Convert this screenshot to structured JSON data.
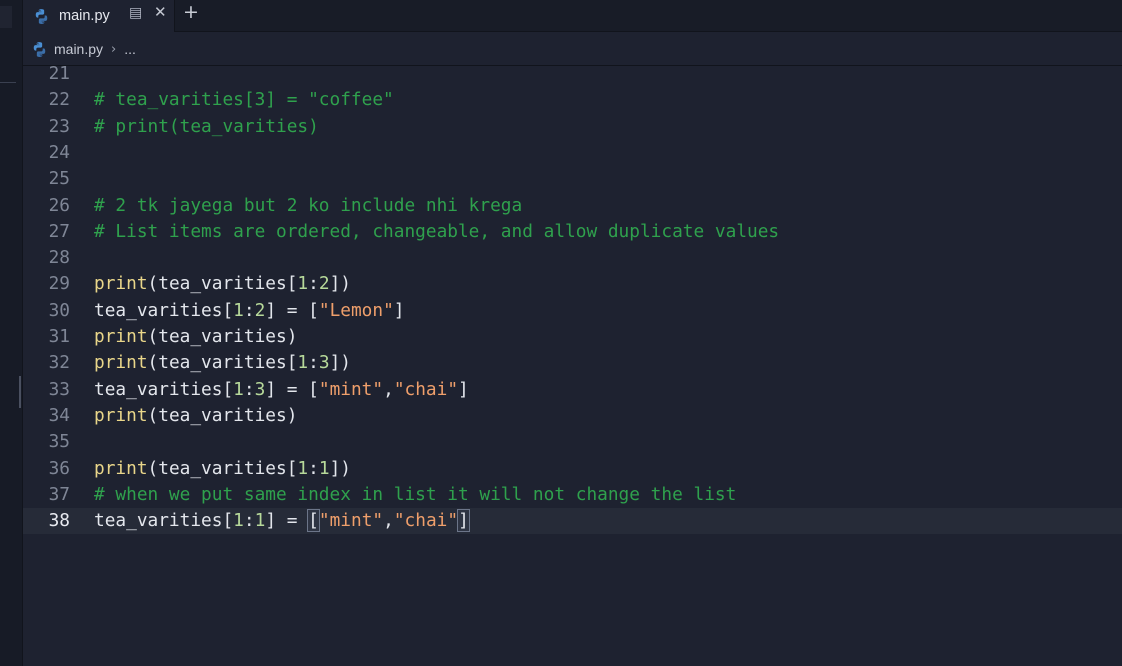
{
  "tab": {
    "label": "main.py"
  },
  "breadcrumb": {
    "file": "main.py",
    "more": "..."
  },
  "colors": {
    "comment": "#2fa14d",
    "function": "#e9d68a",
    "number": "#b7d99a",
    "string": "#ef9f6b"
  },
  "editor": {
    "current_line": "38",
    "lines": [
      {
        "n": "21",
        "tokens": []
      },
      {
        "n": "22",
        "tokens": [
          {
            "t": "c",
            "v": "# tea_varities[3] = \"coffee\""
          }
        ]
      },
      {
        "n": "23",
        "tokens": [
          {
            "t": "c",
            "v": "# print(tea_varities)"
          }
        ]
      },
      {
        "n": "24",
        "tokens": []
      },
      {
        "n": "25",
        "tokens": []
      },
      {
        "n": "26",
        "tokens": [
          {
            "t": "c",
            "v": "# 2 tk jayega but 2 ko include nhi krega"
          }
        ]
      },
      {
        "n": "27",
        "tokens": [
          {
            "t": "c",
            "v": "# List items are ordered, changeable, and allow duplicate values"
          }
        ]
      },
      {
        "n": "28",
        "tokens": []
      },
      {
        "n": "29",
        "tokens": [
          {
            "t": "f",
            "v": "print"
          },
          {
            "t": "p",
            "v": "(tea_varities["
          },
          {
            "t": "n",
            "v": "1"
          },
          {
            "t": "p",
            "v": ":"
          },
          {
            "t": "n",
            "v": "2"
          },
          {
            "t": "p",
            "v": "])"
          }
        ]
      },
      {
        "n": "30",
        "tokens": [
          {
            "t": "p",
            "v": "tea_varities["
          },
          {
            "t": "n",
            "v": "1"
          },
          {
            "t": "p",
            "v": ":"
          },
          {
            "t": "n",
            "v": "2"
          },
          {
            "t": "p",
            "v": "] = ["
          },
          {
            "t": "s",
            "v": "\"Lemon\""
          },
          {
            "t": "p",
            "v": "]"
          }
        ]
      },
      {
        "n": "31",
        "tokens": [
          {
            "t": "f",
            "v": "print"
          },
          {
            "t": "p",
            "v": "(tea_varities)"
          }
        ]
      },
      {
        "n": "32",
        "tokens": [
          {
            "t": "f",
            "v": "print"
          },
          {
            "t": "p",
            "v": "(tea_varities["
          },
          {
            "t": "n",
            "v": "1"
          },
          {
            "t": "p",
            "v": ":"
          },
          {
            "t": "n",
            "v": "3"
          },
          {
            "t": "p",
            "v": "])"
          }
        ]
      },
      {
        "n": "33",
        "tokens": [
          {
            "t": "p",
            "v": "tea_varities["
          },
          {
            "t": "n",
            "v": "1"
          },
          {
            "t": "p",
            "v": ":"
          },
          {
            "t": "n",
            "v": "3"
          },
          {
            "t": "p",
            "v": "] = ["
          },
          {
            "t": "s",
            "v": "\"mint\""
          },
          {
            "t": "p",
            "v": ","
          },
          {
            "t": "s",
            "v": "\"chai\""
          },
          {
            "t": "p",
            "v": "]"
          }
        ]
      },
      {
        "n": "34",
        "tokens": [
          {
            "t": "f",
            "v": "print"
          },
          {
            "t": "p",
            "v": "(tea_varities)"
          }
        ]
      },
      {
        "n": "35",
        "tokens": []
      },
      {
        "n": "36",
        "tokens": [
          {
            "t": "f",
            "v": "print"
          },
          {
            "t": "p",
            "v": "(tea_varities["
          },
          {
            "t": "n",
            "v": "1"
          },
          {
            "t": "p",
            "v": ":"
          },
          {
            "t": "n",
            "v": "1"
          },
          {
            "t": "p",
            "v": "])"
          }
        ]
      },
      {
        "n": "37",
        "tokens": [
          {
            "t": "c",
            "v": "# when we put same index in list it will not change the list"
          }
        ]
      },
      {
        "n": "38",
        "tokens": [
          {
            "t": "p",
            "v": "tea_varities["
          },
          {
            "t": "n",
            "v": "1"
          },
          {
            "t": "p",
            "v": ":"
          },
          {
            "t": "n",
            "v": "1"
          },
          {
            "t": "p",
            "v": "] = "
          },
          {
            "t": "m",
            "v": "["
          },
          {
            "t": "s",
            "v": "\"mint\""
          },
          {
            "t": "p",
            "v": ","
          },
          {
            "t": "s",
            "v": "\"chai\""
          },
          {
            "t": "m",
            "v": "]"
          }
        ]
      }
    ]
  }
}
